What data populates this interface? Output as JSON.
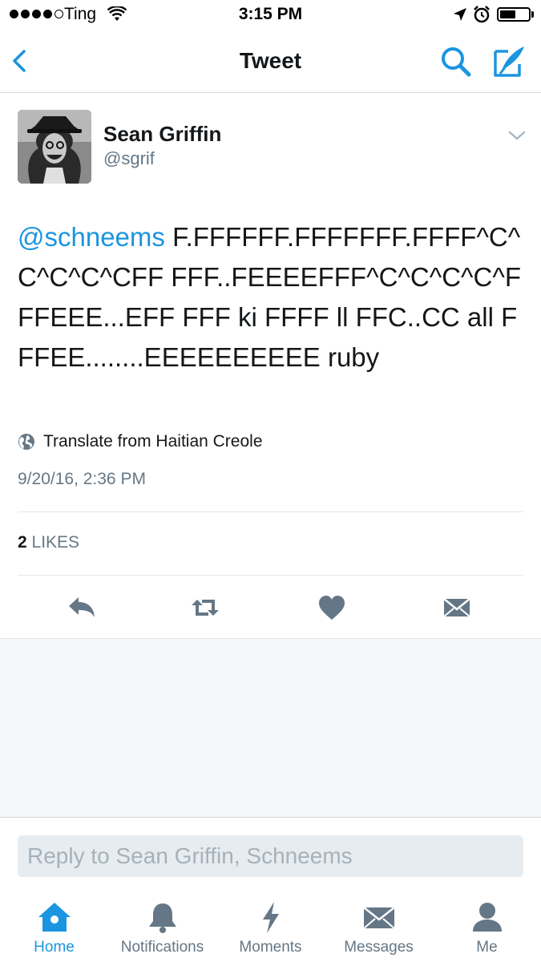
{
  "status_bar": {
    "carrier": "Ting",
    "time": "3:15 PM",
    "signal_bars_filled": 4,
    "signal_bars_total": 5,
    "battery_level": 0.55
  },
  "nav": {
    "title": "Tweet",
    "back_icon": "chevron-left-icon",
    "search_icon": "search-icon",
    "compose_icon": "compose-icon"
  },
  "tweet": {
    "author_name": "Sean Griffin",
    "author_handle": "@sgrif",
    "mention": "@schneems",
    "text": " F.FFFFFF.FFFFFFF.FFFF^C^C^C^C^CFF FFF..FEEEEFFF^C^C^C^C^FFFEEE...EFF FFF ki FFFF ll FFC..CC all FFFEE........EEEEEEEEEE ruby",
    "translate_label": "Translate from Haitian Creole",
    "timestamp": "9/20/16, 2:36 PM",
    "likes_count": "2",
    "likes_label": "LIKES"
  },
  "actions": [
    {
      "name": "reply",
      "icon": "reply-icon"
    },
    {
      "name": "retweet",
      "icon": "retweet-icon"
    },
    {
      "name": "like",
      "icon": "heart-icon"
    },
    {
      "name": "direct-message",
      "icon": "envelope-icon"
    }
  ],
  "reply": {
    "placeholder": "Reply to Sean Griffin, Schneems"
  },
  "tabs": [
    {
      "label": "Home",
      "icon": "home-icon",
      "active": true
    },
    {
      "label": "Notifications",
      "icon": "bell-icon",
      "active": false
    },
    {
      "label": "Moments",
      "icon": "lightning-icon",
      "active": false
    },
    {
      "label": "Messages",
      "icon": "envelope-icon",
      "active": false
    },
    {
      "label": "Me",
      "icon": "person-icon",
      "active": false
    }
  ],
  "colors": {
    "accent": "#1b95e0",
    "icon_gray": "#657786",
    "text": "#14171a",
    "background_gray": "#f5f8fa"
  }
}
